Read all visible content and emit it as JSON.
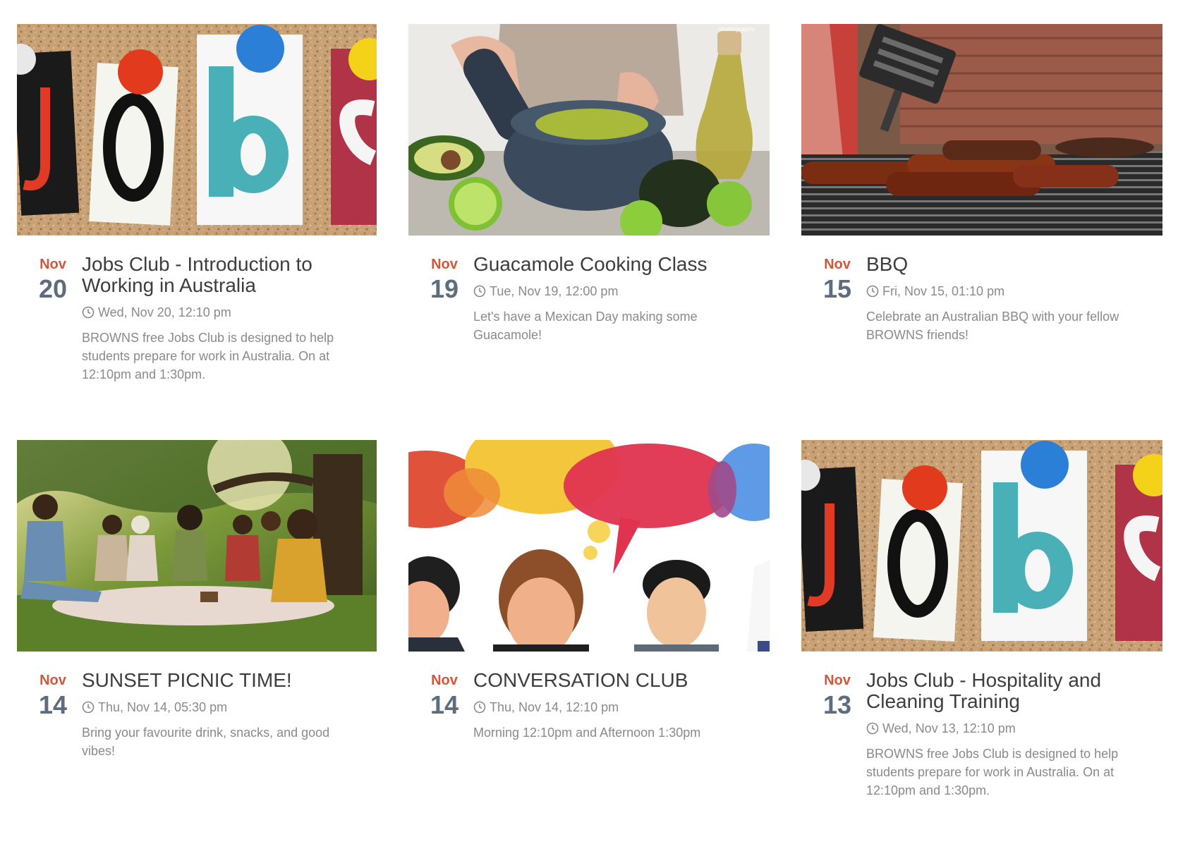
{
  "events": [
    {
      "month": "Nov",
      "day": "20",
      "title": "Jobs Club - Introduction to Working in Australia",
      "time": "Wed, Nov 20, 12:10 pm",
      "description": "BROWNS free Jobs Club is designed to help students prepare for work in Australia. On at 12:10pm and 1:30pm.",
      "image": "jobs-letters-corkboard-image"
    },
    {
      "month": "Nov",
      "day": "19",
      "title": "Guacamole Cooking Class",
      "time": "Tue, Nov 19, 12:00 pm",
      "description": "Let's have a Mexican Day making some Guacamole!",
      "image": "guacamole-mortar-image",
      "image_watermark": "photography"
    },
    {
      "month": "Nov",
      "day": "15",
      "title": "BBQ",
      "time": "Fri, Nov 15, 01:10 pm",
      "description": "Celebrate an Australian BBQ with your fellow BROWNS friends!",
      "image": "bbq-sausages-grill-image"
    },
    {
      "month": "Nov",
      "day": "14",
      "title": "SUNSET PICNIC TIME!",
      "time": "Thu, Nov 14, 05:30 pm",
      "description": "Bring your favourite drink, snacks, and good vibes!",
      "image": "picnic-friends-park-image"
    },
    {
      "month": "Nov",
      "day": "14",
      "title": "CONVERSATION CLUB",
      "time": "Thu, Nov 14, 12:10 pm",
      "description": "Morning 12:10pm and Afternoon 1:30pm",
      "image": "speech-bubbles-people-image"
    },
    {
      "month": "Nov",
      "day": "13",
      "title": "Jobs Club - Hospitality and Cleaning Training",
      "time": "Wed, Nov 13, 12:10 pm",
      "description": "BROWNS free Jobs Club is designed to help students prepare for work in Australia. On at 12:10pm and 1:30pm.",
      "image": "jobs-letters-corkboard-image"
    }
  ],
  "icons": {
    "time": "clock-icon"
  },
  "colors": {
    "month": "#d0573a",
    "day": "#5d6d7e",
    "title": "#3d3d3d",
    "meta": "#8a8a8a"
  }
}
